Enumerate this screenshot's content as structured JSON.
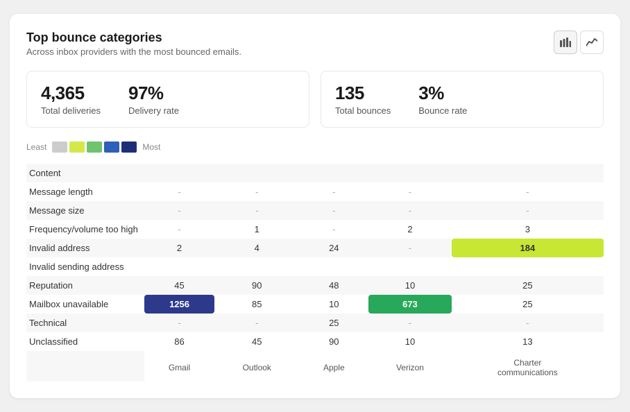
{
  "card": {
    "title": "Top bounce categories",
    "subtitle": "Across inbox providers with the most bounced emails."
  },
  "stats": {
    "left": [
      {
        "value": "4,365",
        "label": "Total deliveries"
      },
      {
        "value": "97%",
        "label": "Delivery rate"
      }
    ],
    "right": [
      {
        "value": "135",
        "label": "Total bounces"
      },
      {
        "value": "3%",
        "label": "Bounce rate"
      }
    ]
  },
  "legend": {
    "least": "Least",
    "most": "Most",
    "swatches": [
      "#cccccc",
      "#d4e84a",
      "#6fc46f",
      "#2d60b8",
      "#1e2f7a"
    ]
  },
  "table": {
    "columns": [
      "Gmail",
      "Outlook",
      "Apple",
      "Verizon",
      "Charter\ncommunications"
    ],
    "rows": [
      {
        "category": "Content",
        "values": [
          "",
          "",
          "",
          "",
          ""
        ]
      },
      {
        "category": "Message length",
        "values": [
          "-",
          "-",
          "-",
          "-",
          "-"
        ]
      },
      {
        "category": "Message size",
        "values": [
          "-",
          "-",
          "-",
          "-",
          "-"
        ]
      },
      {
        "category": "Frequency/volume too high",
        "values": [
          "-",
          "1",
          "-",
          "2",
          "3"
        ]
      },
      {
        "category": "Invalid address",
        "values": [
          "2",
          "4",
          "24",
          "-",
          "184"
        ]
      },
      {
        "category": "Invalid sending address",
        "values": [
          "",
          "",
          "",
          "",
          ""
        ]
      },
      {
        "category": "Reputation",
        "values": [
          "45",
          "90",
          "48",
          "10",
          "25"
        ]
      },
      {
        "category": "Mailbox unavailable",
        "values": [
          "1256",
          "85",
          "10",
          "673",
          "25"
        ]
      },
      {
        "category": "Technical",
        "values": [
          "-",
          "-",
          "25",
          "-",
          "-"
        ]
      },
      {
        "category": "Unclassified",
        "values": [
          "86",
          "45",
          "90",
          "10",
          "13"
        ]
      }
    ],
    "highlights": {
      "invalid_address_charter": true,
      "mailbox_gmail": true,
      "mailbox_verizon": true
    }
  }
}
